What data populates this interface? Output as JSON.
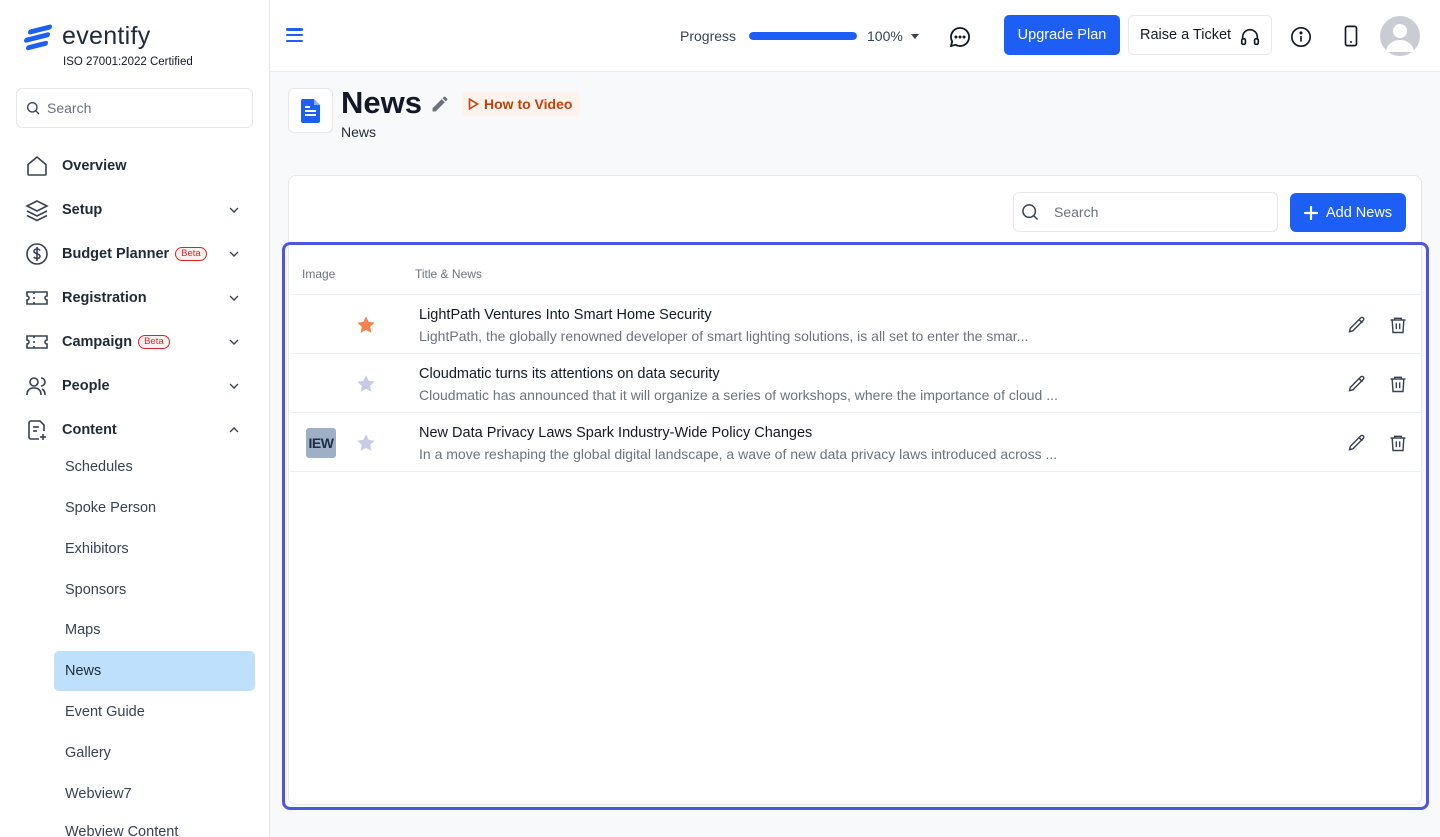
{
  "brand": {
    "name": "eventify",
    "certification": "ISO 27001:2022 Certified",
    "color": "#1d5ef5"
  },
  "sidebar": {
    "search_placeholder": "Search",
    "nav": [
      {
        "label": "Overview",
        "icon": "home-icon"
      },
      {
        "label": "Setup",
        "icon": "layers-icon"
      },
      {
        "label": "Budget Planner",
        "icon": "dollar-icon",
        "badge": "Beta"
      },
      {
        "label": "Registration",
        "icon": "ticket-icon"
      },
      {
        "label": "Campaign",
        "icon": "ticket-icon",
        "badge": "Beta"
      },
      {
        "label": "People",
        "icon": "users-icon"
      },
      {
        "label": "Content",
        "icon": "content-icon"
      }
    ],
    "content_items": [
      "Schedules",
      "Spoke Person",
      "Exhibitors",
      "Sponsors",
      "Maps",
      "News",
      "Event Guide",
      "Gallery",
      "Webview7",
      "Webview Content"
    ],
    "active_item": "News"
  },
  "topbar": {
    "progress_label": "Progress",
    "progress_value": 100,
    "progress_text": "100%",
    "upgrade_label": "Upgrade Plan",
    "ticket_label": "Raise a Ticket"
  },
  "page": {
    "title": "News",
    "subtitle": "News",
    "how_to_label": "How to Video"
  },
  "list": {
    "search_placeholder": "Search",
    "add_label": "Add News",
    "columns": [
      "Image",
      "Title & News"
    ],
    "rows": [
      {
        "title": "LightPath Ventures Into Smart Home Security",
        "description": "LightPath, the globally renowned developer of smart lighting solutions, is all set to enter the smar...",
        "starred": true,
        "thumb_text": ""
      },
      {
        "title": "Cloudmatic turns its attentions on data security",
        "description": "Cloudmatic has announced that it will organize a series of workshops, where the importance of cloud ...",
        "starred": false,
        "thumb_text": ""
      },
      {
        "title": "New Data Privacy Laws Spark Industry-Wide Policy Changes",
        "description": "In a move reshaping the global digital landscape, a wave of new data privacy laws introduced across ...",
        "starred": false,
        "thumb_text": "IEW"
      }
    ]
  },
  "colors": {
    "star_active": "#f0844b",
    "star_inactive": "#c7cbe6",
    "highlight": "#4f55e0"
  }
}
